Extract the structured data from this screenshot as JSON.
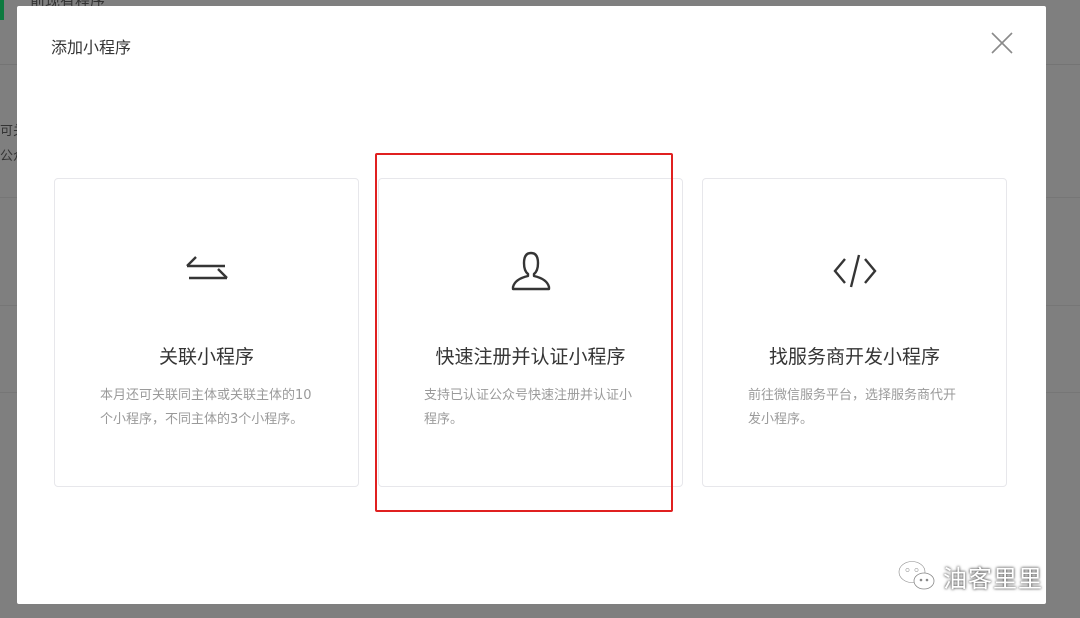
{
  "background": {
    "page_title": "前现有程序",
    "side_text_1": "可关",
    "side_text_2": "公众"
  },
  "dialog": {
    "title": "添加小程序",
    "close_icon": "close-icon",
    "cards": [
      {
        "icon": "swap-arrows-icon",
        "title": "关联小程序",
        "desc": "本月还可关联同主体或关联主体的10个小程序，不同主体的3个小程序。"
      },
      {
        "icon": "user-icon",
        "title": "快速注册并认证小程序",
        "desc": "支持已认证公众号快速注册并认证小程序。"
      },
      {
        "icon": "code-icon",
        "title": "找服务商开发小程序",
        "desc": "前往微信服务平台，选择服务商代开发小程序。"
      }
    ]
  },
  "watermark": {
    "text": "油客里里",
    "icon": "wechat-icon"
  },
  "colors": {
    "highlight": "#e02020",
    "accent": "#0d7a3f",
    "text": "#353535",
    "muted": "#9a9a9a"
  }
}
